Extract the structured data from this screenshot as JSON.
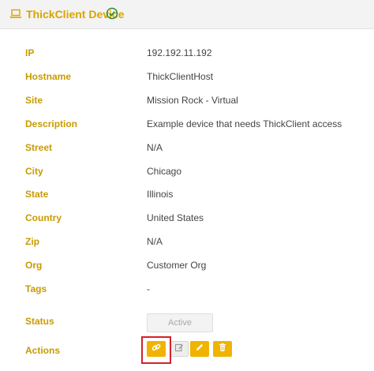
{
  "header": {
    "title": "ThickClient Device",
    "icon": "laptop-icon",
    "status_icon": "check-circle-icon",
    "accent_color": "#d9a400"
  },
  "fields": {
    "ip": {
      "label": "IP",
      "value": "192.192.11.192"
    },
    "hostname": {
      "label": "Hostname",
      "value": "ThickClientHost"
    },
    "site": {
      "label": "Site",
      "value": "Mission Rock - Virtual"
    },
    "description": {
      "label": "Description",
      "value": "Example device that needs ThickClient access"
    },
    "street": {
      "label": "Street",
      "value": "N/A"
    },
    "city": {
      "label": "City",
      "value": "Chicago"
    },
    "state": {
      "label": "State",
      "value": "Illinois"
    },
    "country": {
      "label": "Country",
      "value": "United States"
    },
    "zip": {
      "label": "Zip",
      "value": "N/A"
    },
    "org": {
      "label": "Org",
      "value": "Customer Org"
    },
    "tags": {
      "label": "Tags",
      "value": "-"
    }
  },
  "status": {
    "label": "Status",
    "value": "Active"
  },
  "actions": {
    "label": "Actions",
    "buttons": [
      {
        "icon": "link-icon",
        "color": "#f0b400"
      },
      {
        "icon": "edit-icon",
        "color": "#eeeeee"
      },
      {
        "icon": "pencil-icon",
        "color": "#f0b400"
      },
      {
        "icon": "trash-icon",
        "color": "#f0b400"
      }
    ],
    "highlight_color": "#d6202a"
  }
}
